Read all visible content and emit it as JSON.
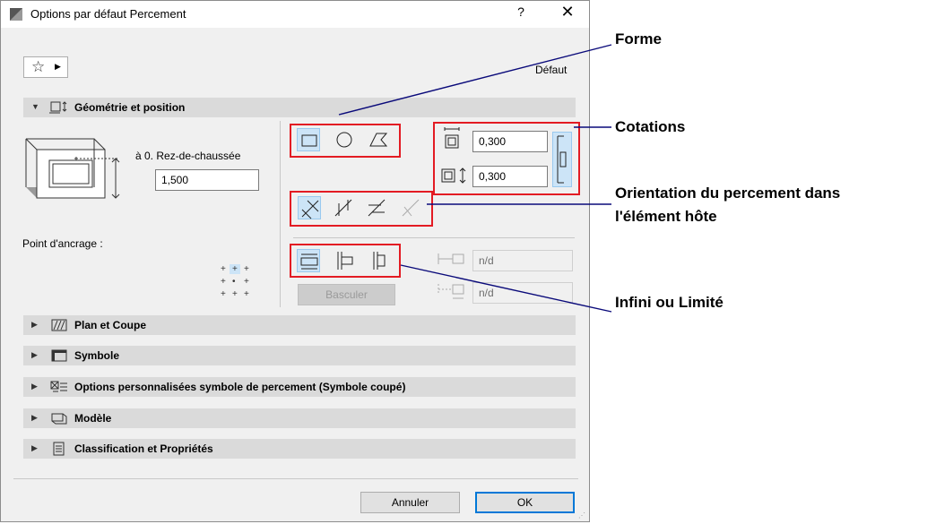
{
  "dialog": {
    "title": "Options par défaut Percement",
    "help": "?",
    "close": "✕",
    "favorites_label": "☆ ▸",
    "default_label": "Défaut"
  },
  "geometry": {
    "section_title": "Géométrie et position",
    "story_label": "à 0. Rez-de-chaussée",
    "elevation_value": "1,500",
    "anchor_label": "Point d'ancrage :",
    "width_value": "0,300",
    "height_value": "0,300",
    "nd_top": "n/d",
    "nd_bottom": "n/d",
    "flip_button": "Basculer"
  },
  "sections": [
    {
      "label": "Plan et Coupe",
      "icon": "plan-section-icon"
    },
    {
      "label": "Symbole",
      "icon": "symbol-icon"
    },
    {
      "label": "Options personnalisées symbole de percement (Symbole coupé)",
      "icon": "custom-symbol-icon"
    },
    {
      "label": "Modèle",
      "icon": "model-icon"
    },
    {
      "label": "Classification et Propriétés",
      "icon": "classification-icon"
    }
  ],
  "footer": {
    "cancel": "Annuler",
    "ok": "OK"
  },
  "annotations": {
    "forme": "Forme",
    "cotations": "Cotations",
    "orientation_line1": "Orientation du percement dans",
    "orientation_line2": "l'élément hôte",
    "infini": "Infini ou Limité"
  },
  "colors": {
    "highlight_box": "#e31b23",
    "pointer_line": "#0a0a7a",
    "selected_tool": "#cce4f7"
  }
}
